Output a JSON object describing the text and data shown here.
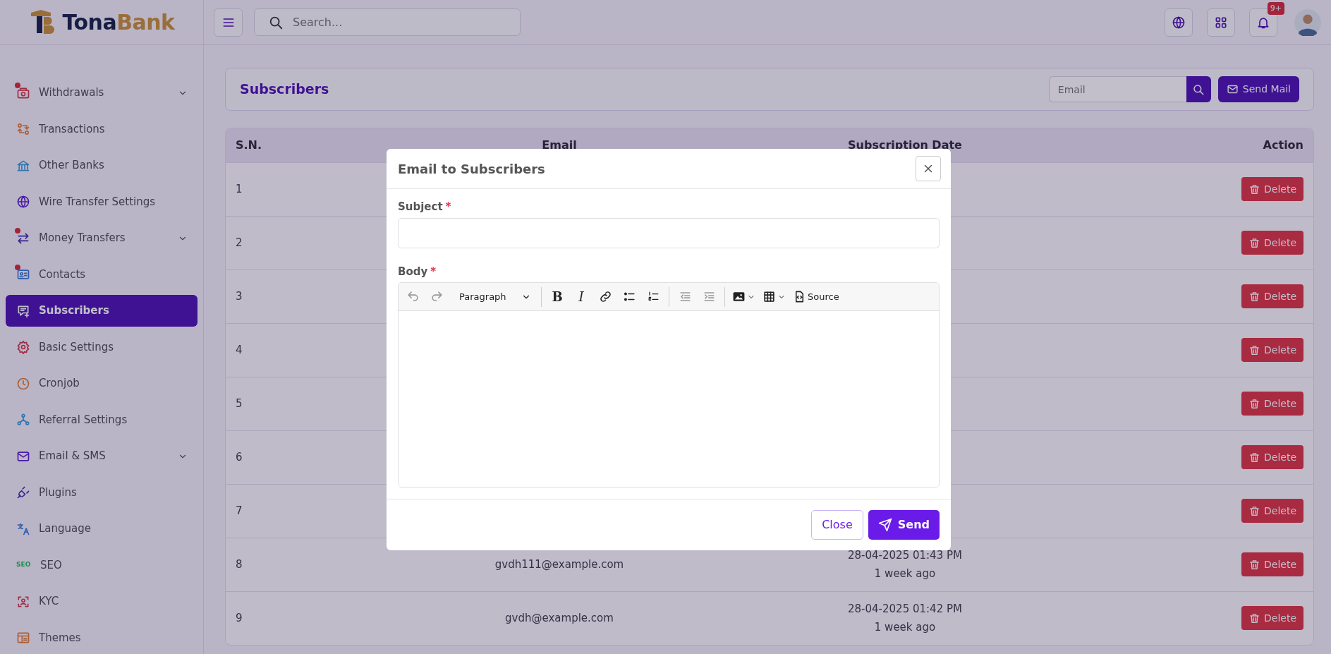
{
  "brand": {
    "first": "Tona",
    "second": "Bank"
  },
  "sidebar": {
    "items": [
      {
        "label": "Withdrawals",
        "selected": false,
        "expandable": true,
        "alert": true
      },
      {
        "label": "Transactions",
        "selected": false,
        "expandable": false,
        "alert": false
      },
      {
        "label": "Other Banks",
        "selected": false,
        "expandable": false,
        "alert": false
      },
      {
        "label": "Wire Transfer Settings",
        "selected": false,
        "expandable": false,
        "alert": false
      },
      {
        "label": "Money Transfers",
        "selected": false,
        "expandable": true,
        "alert": true
      },
      {
        "label": "Contacts",
        "selected": false,
        "expandable": false,
        "alert": true
      },
      {
        "label": "Subscribers",
        "selected": true,
        "expandable": false,
        "alert": false
      },
      {
        "label": "Basic Settings",
        "selected": false,
        "expandable": false,
        "alert": false
      },
      {
        "label": "Cronjob",
        "selected": false,
        "expandable": false,
        "alert": false
      },
      {
        "label": "Referral Settings",
        "selected": false,
        "expandable": false,
        "alert": false
      },
      {
        "label": "Email & SMS",
        "selected": false,
        "expandable": true,
        "alert": false
      },
      {
        "label": "Plugins",
        "selected": false,
        "expandable": false,
        "alert": false
      },
      {
        "label": "Language",
        "selected": false,
        "expandable": false,
        "alert": false
      },
      {
        "label": "SEO",
        "icon_text": "SEO",
        "selected": false,
        "expandable": false,
        "alert": false
      },
      {
        "label": "KYC",
        "selected": false,
        "expandable": false,
        "alert": false
      },
      {
        "label": "Themes",
        "selected": false,
        "expandable": false,
        "alert": false
      }
    ]
  },
  "topbar": {
    "search": {
      "placeholder": "Search..."
    },
    "notification_badge": "9+"
  },
  "page": {
    "title": "Subscribers",
    "email_filter": {
      "placeholder": "Email"
    },
    "send_mail_button": "Send Mail"
  },
  "table": {
    "columns": [
      "S.N.",
      "Email",
      "Subscription Date",
      "Action"
    ],
    "rows": [
      {
        "sn": "1",
        "action": "Delete"
      },
      {
        "sn": "2",
        "action": "Delete"
      },
      {
        "sn": "3",
        "action": "Delete"
      },
      {
        "sn": "4",
        "action": "Delete"
      },
      {
        "sn": "5",
        "action": "Delete"
      },
      {
        "sn": "6",
        "action": "Delete"
      },
      {
        "sn": "7",
        "action": "Delete"
      },
      {
        "sn": "8",
        "email": "gvdh111@example.com",
        "date": "28-04-2025 01:43 PM",
        "relative": "1 week ago",
        "action": "Delete"
      },
      {
        "sn": "9",
        "email": "gvdh@example.com",
        "date": "28-04-2025 01:42 PM",
        "relative": "1 week ago",
        "action": "Delete"
      }
    ]
  },
  "modal": {
    "title": "Email to Subscribers",
    "fields": [
      {
        "kind": "input",
        "label": "Subject",
        "required_mark": "*"
      },
      {
        "kind": "editor",
        "label": "Body",
        "required_mark": "*"
      }
    ],
    "toolbar": [
      {
        "kind": "undo",
        "disabled": true
      },
      {
        "kind": "redo",
        "disabled": true
      },
      {
        "kind": "dropdown",
        "label": "Paragraph"
      },
      {
        "kind": "separator"
      },
      {
        "kind": "bold",
        "glyph": "B",
        "disabled": false
      },
      {
        "kind": "italic",
        "glyph": "I",
        "disabled": false
      },
      {
        "kind": "link",
        "disabled": false
      },
      {
        "kind": "bullets",
        "disabled": false
      },
      {
        "kind": "numbers",
        "disabled": false
      },
      {
        "kind": "separator"
      },
      {
        "kind": "outdent",
        "disabled": true
      },
      {
        "kind": "indent",
        "disabled": true
      },
      {
        "kind": "separator"
      },
      {
        "kind": "image",
        "has_menu": true,
        "disabled": false
      },
      {
        "kind": "table",
        "has_menu": true,
        "disabled": false
      },
      {
        "kind": "source",
        "label": "Source",
        "disabled": false
      }
    ],
    "buttons": [
      {
        "kind": "secondary",
        "label": "Close"
      },
      {
        "kind": "primary",
        "label": "Send"
      }
    ]
  }
}
